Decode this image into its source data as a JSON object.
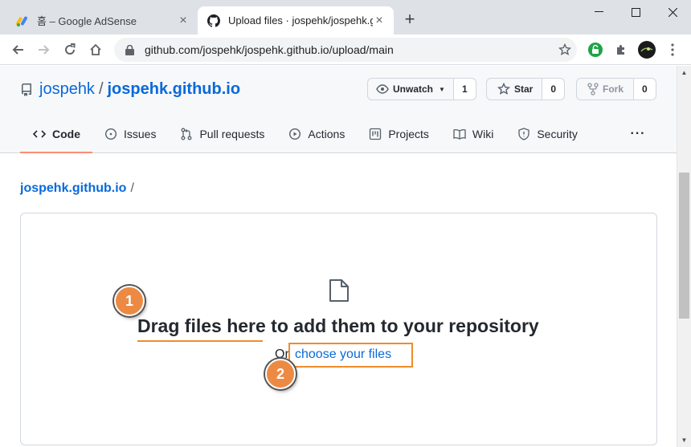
{
  "browser": {
    "tabs": [
      {
        "title": "홈 – Google AdSense",
        "favicon": "adsense-icon"
      },
      {
        "title": "Upload files · jospehk/jospehk.gi",
        "favicon": "github-icon"
      }
    ],
    "new_tab_label": "+",
    "url": "github.com/jospehk/jospehk.github.io/upload/main"
  },
  "repo": {
    "owner": "jospehk",
    "separator": "/",
    "name": "jospehk.github.io",
    "buttons": {
      "unwatch": {
        "label": "Unwatch",
        "count": "1"
      },
      "star": {
        "label": "Star",
        "count": "0"
      },
      "fork": {
        "label": "Fork",
        "count": "0"
      }
    },
    "nav": [
      {
        "label": "Code",
        "icon": "code-icon"
      },
      {
        "label": "Issues",
        "icon": "issue-icon"
      },
      {
        "label": "Pull requests",
        "icon": "pull-request-icon"
      },
      {
        "label": "Actions",
        "icon": "play-icon"
      },
      {
        "label": "Projects",
        "icon": "project-icon"
      },
      {
        "label": "Wiki",
        "icon": "book-icon"
      },
      {
        "label": "Security",
        "icon": "shield-icon"
      }
    ],
    "more": "···"
  },
  "breadcrumb": {
    "root": "jospehk.github.io",
    "slash": "/"
  },
  "upload": {
    "drag_text": "Drag files here to add them to your repository",
    "or_text": "Or",
    "choose_text": "choose your files"
  },
  "annotations": {
    "step1": "1",
    "step2": "2"
  },
  "colors": {
    "accent_link": "#0969da",
    "annotation": "#ec8a44",
    "annotation_outline": "#f08c2a",
    "tab_underline": "#fd8c73"
  }
}
